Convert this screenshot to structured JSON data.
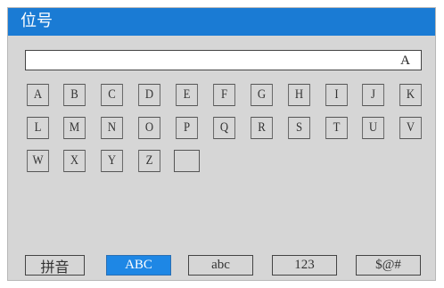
{
  "title": "位号",
  "input": {
    "value": "A"
  },
  "keys": {
    "row1": [
      "A",
      "B",
      "C",
      "D",
      "E",
      "F",
      "G",
      "H",
      "I",
      "J",
      "K"
    ],
    "row2": [
      "L",
      "M",
      "N",
      "O",
      "P",
      "Q",
      "R",
      "S",
      "T",
      "U",
      "V"
    ],
    "row3": [
      "W",
      "X",
      "Y",
      "Z",
      ""
    ]
  },
  "modes": [
    "拼音",
    "ABC",
    "abc",
    "123",
    "$@#"
  ],
  "active_mode": "ABC",
  "colors": {
    "title_bar": "#1a7bd4",
    "active_mode": "#1e87e5",
    "background": "#d6d6d6"
  }
}
